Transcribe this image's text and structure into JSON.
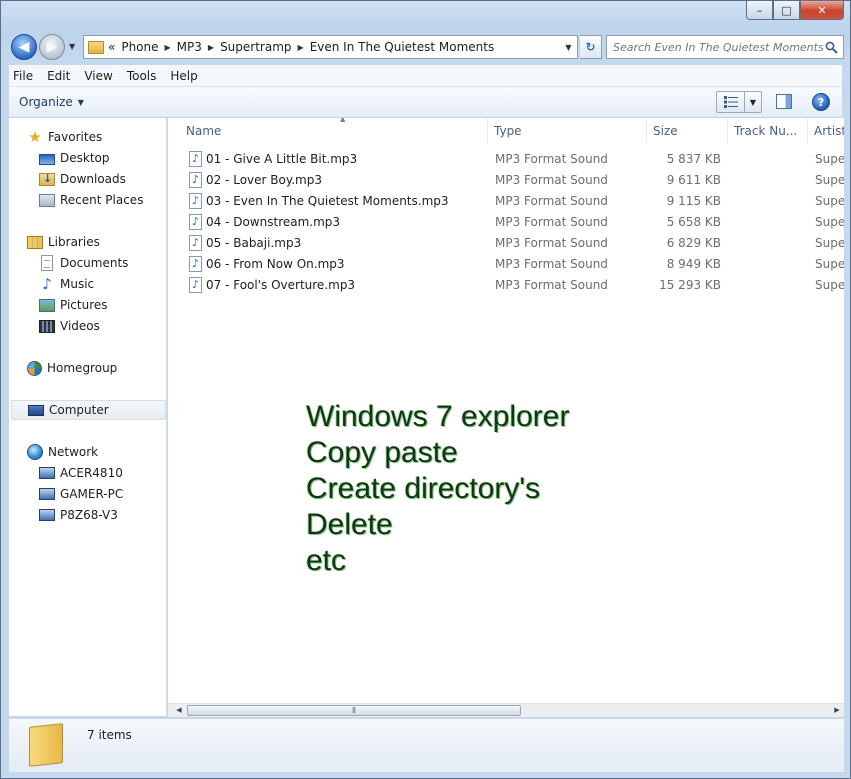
{
  "window": {
    "title_buttons": {
      "minimize": "–",
      "maximize": "□",
      "close": "✕"
    }
  },
  "nav": {
    "back": "◀",
    "forward": "▶"
  },
  "address": {
    "overflow": "«",
    "crumbs": [
      "Phone",
      "MP3",
      "Supertramp",
      "Even In The Quietest Moments"
    ]
  },
  "search": {
    "placeholder": "Search Even In The Quietest Moments"
  },
  "menu": [
    "File",
    "Edit",
    "View",
    "Tools",
    "Help"
  ],
  "toolbar": {
    "organize_label": "Organize"
  },
  "sidebar": {
    "favorites": {
      "label": "Favorites",
      "items": [
        "Desktop",
        "Downloads",
        "Recent Places"
      ]
    },
    "libraries": {
      "label": "Libraries",
      "items": [
        "Documents",
        "Music",
        "Pictures",
        "Videos"
      ]
    },
    "homegroup": "Homegroup",
    "computer": "Computer",
    "network": {
      "label": "Network",
      "items": [
        "ACER4810",
        "GAMER-PC",
        "P8Z68-V3"
      ]
    }
  },
  "columns": [
    "Name",
    "Type",
    "Size",
    "Track Nu...",
    "Artist"
  ],
  "files": [
    {
      "name": "01 - Give A Little Bit.mp3",
      "type": "MP3 Format Sound",
      "size": "5 837 KB",
      "artist": "Supertramp"
    },
    {
      "name": "02 - Lover Boy.mp3",
      "type": "MP3 Format Sound",
      "size": "9 611 KB",
      "artist": "Supertramp"
    },
    {
      "name": "03 - Even In The Quietest Moments.mp3",
      "type": "MP3 Format Sound",
      "size": "9 115 KB",
      "artist": "Supertramp"
    },
    {
      "name": "04 - Downstream.mp3",
      "type": "MP3 Format Sound",
      "size": "5 658 KB",
      "artist": "Supertramp"
    },
    {
      "name": "05 - Babaji.mp3",
      "type": "MP3 Format Sound",
      "size": "6 829 KB",
      "artist": "Supertramp"
    },
    {
      "name": "06 - From Now On.mp3",
      "type": "MP3 Format Sound",
      "size": "8 949 KB",
      "artist": "Supertramp"
    },
    {
      "name": "07 - Fool's Overture.mp3",
      "type": "MP3 Format Sound",
      "size": "15 293 KB",
      "artist": "Supertramp"
    }
  ],
  "overlay": [
    "Windows 7 explorer",
    "Copy paste",
    "Create directory's",
    "Delete",
    "etc"
  ],
  "details": {
    "item_count": "7 items"
  },
  "icons": {
    "back": "back-arrow-icon",
    "forward": "forward-arrow-icon",
    "refresh": "refresh-icon",
    "search": "search-icon",
    "help": "help-icon",
    "mp3": "music-note-icon"
  }
}
